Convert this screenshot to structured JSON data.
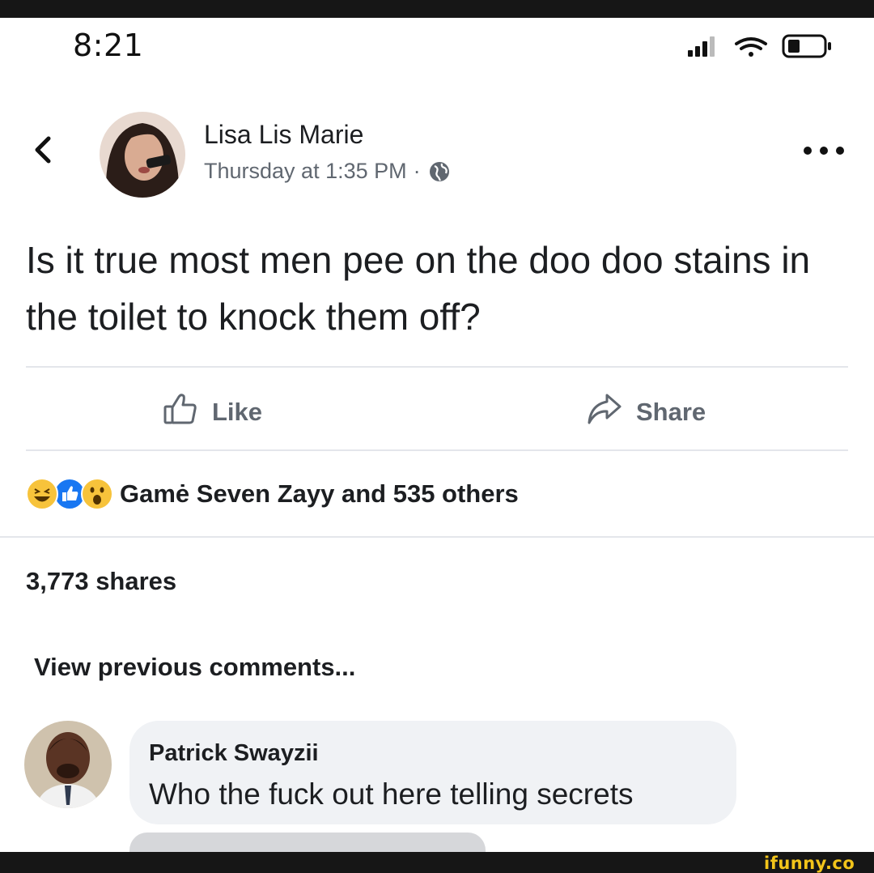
{
  "status_bar": {
    "time": "8:21",
    "icons": [
      "signal-icon",
      "wifi-icon",
      "battery-icon"
    ]
  },
  "post": {
    "author": "Lisa Lis Marie",
    "timestamp": "Thursday at 1:35 PM",
    "separator": "·",
    "privacy_icon": "globe-icon",
    "text": "Is it true most men pee on the doo doo stains in the toilet to knock them off?"
  },
  "actions": {
    "like_label": "Like",
    "share_label": "Share"
  },
  "reactions": {
    "icons": [
      "haha-reaction",
      "like-reaction",
      "wow-reaction"
    ],
    "summary": "Gamė Seven Zayy and 535 others"
  },
  "shares": "3,773 shares",
  "view_previous": "View previous comments...",
  "comment": {
    "author": "Patrick Swayzii",
    "text": "Who the fuck out here telling secrets"
  },
  "watermark": "ifunny.co",
  "colors": {
    "secondary_text": "#606770",
    "primary_text": "#1c1e21",
    "bubble": "#f0f2f5",
    "like_blue": "#1877f2",
    "reaction_yellow": "#f7c33b",
    "watermark_yellow": "#f2c41a"
  }
}
